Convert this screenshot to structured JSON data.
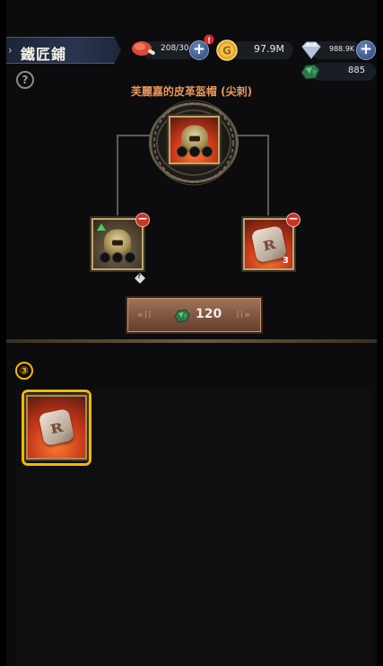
{
  "header": {
    "title": "鐵匠鋪",
    "stamina": "208/30",
    "gold": "97.9M",
    "diamonds": "988.9K",
    "gems": "885"
  },
  "crafting": {
    "item_name": "芙麗嘉的皮革盔帽 (尖刺)",
    "materials": [
      {
        "name": "helmet",
        "count": ""
      },
      {
        "name": "rune-stone",
        "count": "3"
      }
    ],
    "cost": "120",
    "unknown_marker": "?"
  },
  "inventory": {
    "step_label": "③"
  },
  "colors": {
    "accent_orange": "#e8965a",
    "highlight_yellow": "#f5b800",
    "button_brown": "#7e5440"
  },
  "icons": {
    "meat": "drumstick-icon",
    "gold": "gold-coin-icon",
    "diamond": "diamond-icon",
    "gem": "green-gem-icon",
    "help": "question-icon"
  }
}
